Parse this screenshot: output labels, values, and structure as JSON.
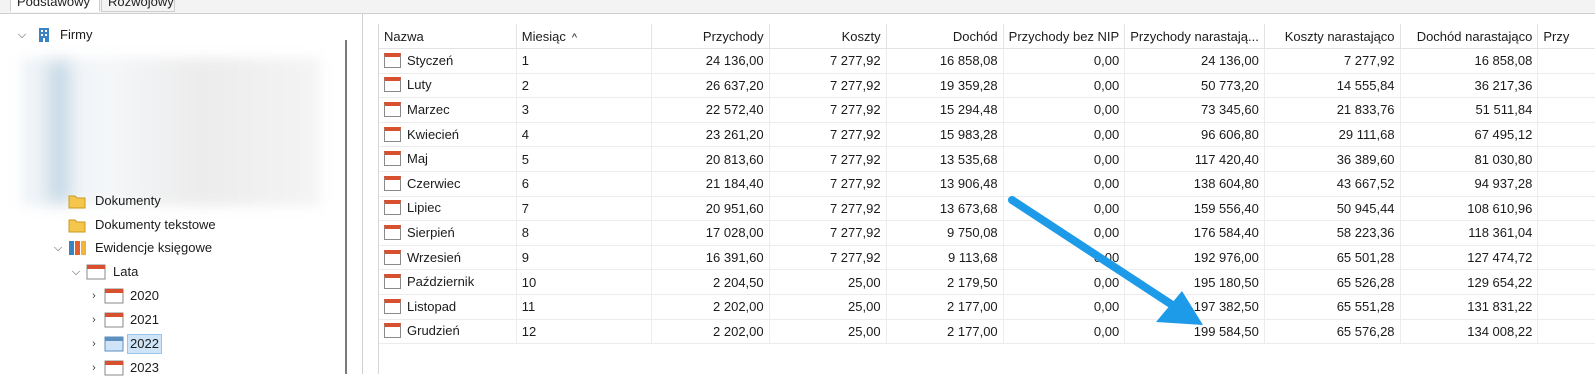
{
  "tabs": [
    {
      "label": "Podstawowy",
      "active": true
    },
    {
      "label": "Rozwojowy",
      "active": false
    }
  ],
  "tree": {
    "root": {
      "label": "Firmy",
      "icon": "building-icon"
    },
    "items": [
      {
        "label": "Dokumenty",
        "icon": "folder-icon"
      },
      {
        "label": "Dokumenty tekstowe",
        "icon": "folder-icon"
      },
      {
        "label": "Ewidencje księgowe",
        "icon": "binders-icon"
      },
      {
        "label": "Lata",
        "icon": "calendar-icon"
      },
      {
        "label": "2020",
        "icon": "calendar-icon"
      },
      {
        "label": "2021",
        "icon": "calendar-icon"
      },
      {
        "label": "2022",
        "icon": "calendar-icon",
        "selected": true
      },
      {
        "label": "2023",
        "icon": "calendar-icon"
      }
    ]
  },
  "table": {
    "columns": [
      "Nazwa",
      "Miesiąc",
      "Przychody",
      "Koszty",
      "Dochód",
      "Przychody bez NIP",
      "Przychody narastają...",
      "Koszty narastająco",
      "Dochód narastająco",
      "Przy"
    ],
    "sort_indicator": "^",
    "rows": [
      [
        "Styczeń",
        "1",
        "24 136,00",
        "7 277,92",
        "16 858,08",
        "0,00",
        "24 136,00",
        "7 277,92",
        "16 858,08"
      ],
      [
        "Luty",
        "2",
        "26 637,20",
        "7 277,92",
        "19 359,28",
        "0,00",
        "50 773,20",
        "14 555,84",
        "36 217,36"
      ],
      [
        "Marzec",
        "3",
        "22 572,40",
        "7 277,92",
        "15 294,48",
        "0,00",
        "73 345,60",
        "21 833,76",
        "51 511,84"
      ],
      [
        "Kwiecień",
        "4",
        "23 261,20",
        "7 277,92",
        "15 983,28",
        "0,00",
        "96 606,80",
        "29 111,68",
        "67 495,12"
      ],
      [
        "Maj",
        "5",
        "20 813,60",
        "7 277,92",
        "13 535,68",
        "0,00",
        "117 420,40",
        "36 389,60",
        "81 030,80"
      ],
      [
        "Czerwiec",
        "6",
        "21 184,40",
        "7 277,92",
        "13 906,48",
        "0,00",
        "138 604,80",
        "43 667,52",
        "94 937,28"
      ],
      [
        "Lipiec",
        "7",
        "20 951,60",
        "7 277,92",
        "13 673,68",
        "0,00",
        "159 556,40",
        "50 945,44",
        "108 610,96"
      ],
      [
        "Sierpień",
        "8",
        "17 028,00",
        "7 277,92",
        "9 750,08",
        "0,00",
        "176 584,40",
        "58 223,36",
        "118 361,04"
      ],
      [
        "Wrzesień",
        "9",
        "16 391,60",
        "7 277,92",
        "9 113,68",
        "0,00",
        "192 976,00",
        "65 501,28",
        "127 474,72"
      ],
      [
        "Październik",
        "10",
        "2 204,50",
        "25,00",
        "2 179,50",
        "0,00",
        "195 180,50",
        "65 526,28",
        "129 654,22"
      ],
      [
        "Listopad",
        "11",
        "2 202,00",
        "25,00",
        "2 177,00",
        "0,00",
        "197 382,50",
        "65 551,28",
        "131 831,22"
      ],
      [
        "Grudzień",
        "12",
        "2 202,00",
        "25,00",
        "2 177,00",
        "0,00",
        "199 584,50",
        "65 576,28",
        "134 008,22"
      ]
    ]
  },
  "annotation": {
    "type": "arrow",
    "color": "#1e9be8"
  },
  "colors": {
    "accent": "#1e9be8",
    "calendar_header": "#d9502e",
    "selection": "#cfe4f7"
  }
}
